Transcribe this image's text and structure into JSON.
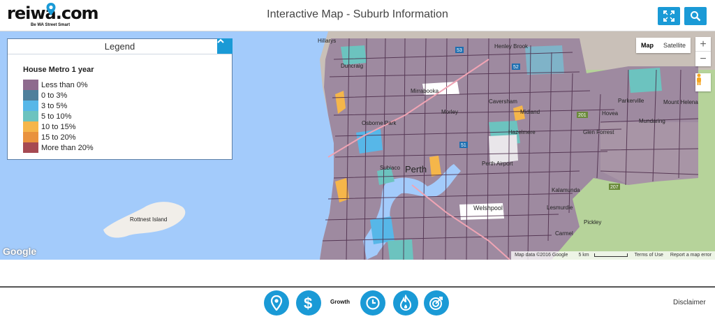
{
  "header": {
    "logo_text": "reiwa",
    "logo_com": ".com",
    "logo_tagline": "Be WA Street Smart",
    "title": "Interactive Map - Suburb Information",
    "buttons": [
      {
        "icon": "fullscreen-icon"
      },
      {
        "icon": "search-icon"
      }
    ]
  },
  "legend": {
    "title": "Legend",
    "subtitle": "House Metro 1 year",
    "items": [
      {
        "label": "Less than 0%",
        "color": "#8e6b8e"
      },
      {
        "label": "0 to 3%",
        "color": "#4f7f9b"
      },
      {
        "label": "3 to 5%",
        "color": "#57b7e8"
      },
      {
        "label": "5 to 10%",
        "color": "#6cc3bf"
      },
      {
        "label": "10 to 15%",
        "color": "#f5b64a"
      },
      {
        "label": "15 to 20%",
        "color": "#e9923e"
      },
      {
        "label": "More than 20%",
        "color": "#a64a52"
      }
    ]
  },
  "map": {
    "type_controls": [
      "Map",
      "Satellite"
    ],
    "active_type": "Map",
    "zoom_in": "+",
    "zoom_out": "−",
    "google_label": "Google",
    "attribution": {
      "data": "Map data ©2016 Google",
      "scale": "5 km",
      "terms": "Terms of Use",
      "report": "Report a map error"
    },
    "labels": [
      "Hillarys",
      "Henley Brook",
      "Duncraig",
      "Mirrabooka",
      "Morley",
      "Caversham",
      "Midland",
      "Parkerville",
      "Mount Helena",
      "Hovea",
      "Mundaring",
      "Osborne Park",
      "Hazelmere",
      "Glen Forrest",
      "Perth",
      "Subiaco",
      "Perth Airport",
      "Kalamunda",
      "Welshpool",
      "Lesmurdie",
      "Rottnest Island",
      "Pickley",
      "Carmel"
    ],
    "road_shields": [
      "53",
      "52",
      "201",
      "51",
      "207"
    ]
  },
  "footer": {
    "nav": [
      {
        "icon": "map-pin-icon"
      },
      {
        "icon": "dollar-icon"
      },
      {
        "icon": "clock-icon"
      },
      {
        "icon": "flame-icon"
      },
      {
        "icon": "target-icon"
      }
    ],
    "growth_label": "Growth",
    "disclaimer": "Disclaimer"
  }
}
